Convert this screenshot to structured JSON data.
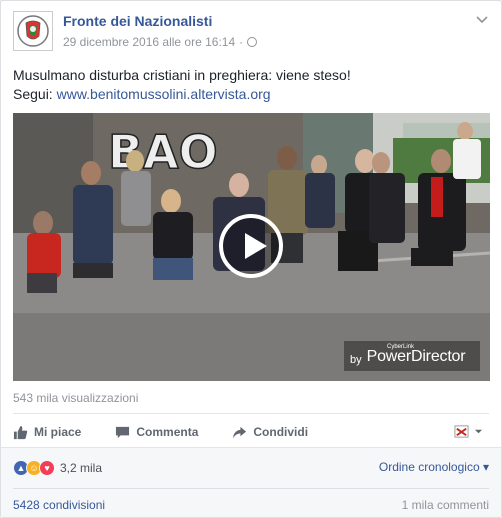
{
  "post": {
    "page_name": "Fronte dei Nazionalisti",
    "timestamp": "29 dicembre 2016 alle ore 16:14",
    "separator": "·",
    "text_line1": "Musulmano disturba cristiani in preghiera: viene steso!",
    "text_line2_prefix": "Segui: ",
    "link": "www.benitomussolini.altervista.org"
  },
  "video": {
    "watermark_by": "by",
    "watermark_brand_small": "CyberLink",
    "watermark_name": "PowerDirector",
    "graffiti_text": "BAO"
  },
  "stats": {
    "views": "543 mila visualizzazioni",
    "reactions_count": "3,2 mila",
    "order_label": "Ordine cronologico",
    "order_caret": "▾",
    "shares": "5428 condivisioni",
    "comments": "1 mila commenti"
  },
  "actions": {
    "like": "Mi piace",
    "comment": "Commenta",
    "share": "Condividi"
  },
  "icons": {
    "menu_chevron": "chevron-down-icon",
    "globe": "globe-icon",
    "play": "play-icon"
  },
  "colors": {
    "link": "#365899",
    "like_blue": "#4267b2",
    "haha_yellow": "#f7b125",
    "love_red": "#f33e58",
    "muted_text": "#90949c"
  }
}
